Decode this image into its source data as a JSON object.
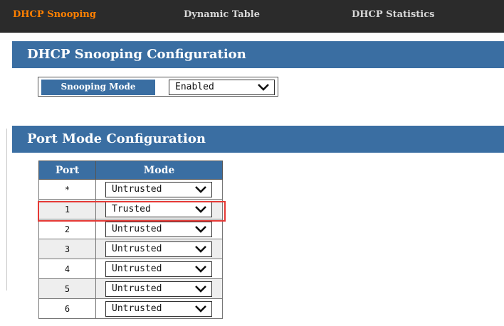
{
  "topnav": {
    "tabs": [
      {
        "label": "DHCP Snooping",
        "active": true
      },
      {
        "label": "Dynamic Table",
        "active": false
      },
      {
        "label": "DHCP Statistics",
        "active": false
      }
    ]
  },
  "snooping_section": {
    "title": "DHCP Snooping Configuration",
    "mode_label": "Snooping Mode",
    "mode_value": "Enabled"
  },
  "port_section": {
    "title": "Port Mode Configuration",
    "columns": [
      "Port",
      "Mode"
    ],
    "rows": [
      {
        "port": "*",
        "mode": "Untrusted"
      },
      {
        "port": "1",
        "mode": "Trusted"
      },
      {
        "port": "2",
        "mode": "Untrusted"
      },
      {
        "port": "3",
        "mode": "Untrusted"
      },
      {
        "port": "4",
        "mode": "Untrusted"
      },
      {
        "port": "5",
        "mode": "Untrusted"
      },
      {
        "port": "6",
        "mode": "Untrusted"
      }
    ]
  },
  "colors": {
    "header_blue": "#3a6ea2",
    "active_tab": "#ff8000",
    "highlight": "#e53935"
  }
}
